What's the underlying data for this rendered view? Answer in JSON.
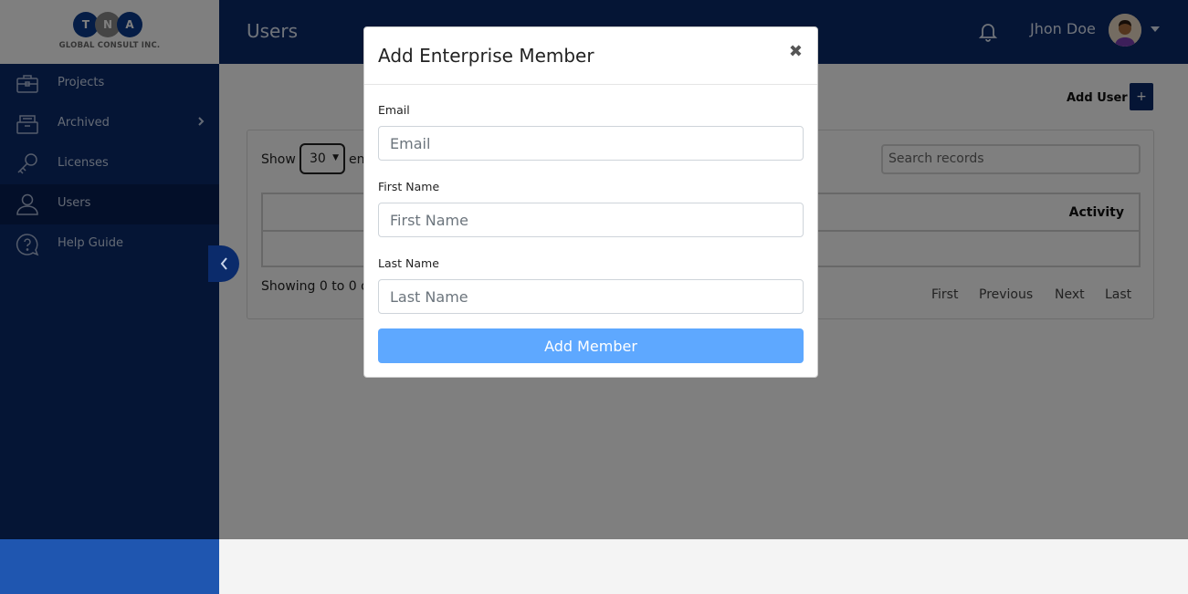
{
  "logo": {
    "letters": [
      "T",
      "N",
      "A"
    ],
    "tagline": "GLOBAL CONSULT INC."
  },
  "sidebar": {
    "items": [
      {
        "label": "Projects",
        "icon": "briefcase-icon"
      },
      {
        "label": "Archived",
        "icon": "archive-box-icon"
      },
      {
        "label": "Licenses",
        "icon": "key-icon"
      },
      {
        "label": "Users",
        "icon": "user-icon"
      },
      {
        "label": "Help Guide",
        "icon": "help-bubble-icon"
      }
    ],
    "active": "Users"
  },
  "header": {
    "title": "Users",
    "user_name": "Jhon Doe"
  },
  "main": {
    "add_user_label": "Add User",
    "add_user_button": "+",
    "show_label": "Show",
    "show_value": "30",
    "entries_label": "en",
    "search_placeholder": "Search records",
    "activity_header": "Activity",
    "showing_text": "Showing 0 to 0 o",
    "pager": {
      "first": "First",
      "previous": "Previous",
      "next": "Next",
      "last": "Last"
    }
  },
  "modal": {
    "title": "Add Enterprise Member",
    "close": "✖",
    "email_label": "Email",
    "email_placeholder": "Email",
    "first_name_label": "First Name",
    "first_name_placeholder": "First Name",
    "last_name_label": "Last Name",
    "last_name_placeholder": "Last Name",
    "submit_label": "Add Member"
  },
  "colors": {
    "sidebar": "#0b2b6b",
    "sidebar_active": "#071f52",
    "accent_footer": "#1f56b0",
    "submit_button": "#5ea8ff"
  }
}
